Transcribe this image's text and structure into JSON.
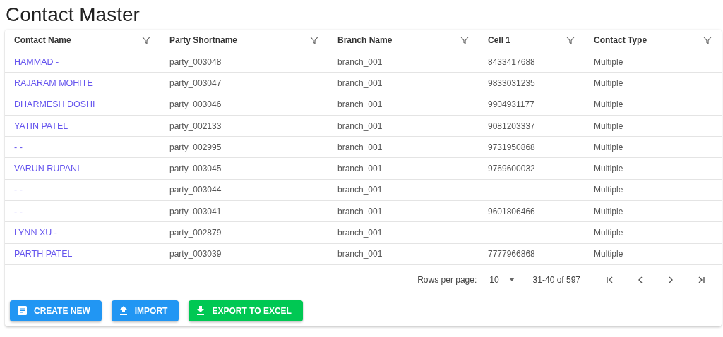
{
  "title": "Contact Master",
  "table": {
    "columns": [
      "Contact Name",
      "Party Shortname",
      "Branch Name",
      "Cell 1",
      "Contact Type"
    ],
    "rows": [
      [
        "HAMMAD -",
        "party_003048",
        "branch_001",
        "8433417688",
        "Multiple"
      ],
      [
        "RAJARAM MOHITE",
        "party_003047",
        "branch_001",
        "9833031235",
        "Multiple"
      ],
      [
        "DHARMESH DOSHI",
        "party_003046",
        "branch_001",
        "9904931177",
        "Multiple"
      ],
      [
        "YATIN PATEL",
        "party_002133",
        "branch_001",
        "9081203337",
        "Multiple"
      ],
      [
        "- -",
        "party_002995",
        "branch_001",
        "9731950868",
        "Multiple"
      ],
      [
        "VARUN RUPANI",
        "party_003045",
        "branch_001",
        "9769600032",
        "Multiple"
      ],
      [
        "- -",
        "party_003044",
        "branch_001",
        null,
        "Multiple"
      ],
      [
        "- -",
        "party_003041",
        "branch_001",
        "9601806466",
        "Multiple"
      ],
      [
        "LYNN XU -",
        "party_002879",
        "branch_001",
        null,
        "Multiple"
      ],
      [
        "PARTH PATEL",
        "party_003039",
        "branch_001",
        "7777966868",
        "Multiple"
      ]
    ]
  },
  "pagination": {
    "rows_per_page_label": "Rows per page:",
    "rows_per_page": "10",
    "range": "31-40 of 597"
  },
  "buttons": [
    {
      "label": "CREATE NEW",
      "kind": "create"
    },
    {
      "label": "IMPORT",
      "kind": "import"
    },
    {
      "label": "EXPORT TO EXCEL",
      "kind": "export"
    }
  ]
}
